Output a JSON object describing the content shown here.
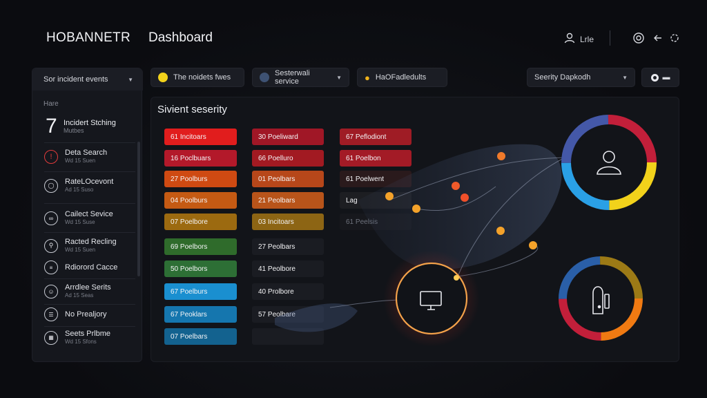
{
  "header": {
    "brand": "HOBANNETR",
    "title": "Dashboard",
    "user_label": "Lrle"
  },
  "sidebar": {
    "select_label": "Sor incident events",
    "section_label": "Hare",
    "feature": {
      "number": "7",
      "title": "Incidert Stching",
      "subtitle": "Mutbes"
    },
    "items": [
      {
        "title": "Deta Search",
        "subtitle": "Wd 15 Suen",
        "icon": "alert-icon"
      },
      {
        "title": "RateLOcevont",
        "subtitle": "Ad 15 Suso",
        "icon": "shield-icon"
      },
      {
        "title": "Cailect Sevice",
        "subtitle": "Wd 15 Suse",
        "icon": "service-icon"
      },
      {
        "title": "Racted Recling",
        "subtitle": "Wd 15 Suen",
        "icon": "search-icon"
      },
      {
        "title": "Rdiorord Cacce",
        "subtitle": "",
        "icon": "list-icon"
      },
      {
        "title": "Arrdlee Serits",
        "subtitle": "Ad 15 Seas",
        "icon": "person-icon"
      },
      {
        "title": "No Prealjory",
        "subtitle": "",
        "icon": "stack-icon"
      },
      {
        "title": "Seets Prlbme",
        "subtitle": "Wd 15 Sfons",
        "icon": "grid-icon"
      }
    ]
  },
  "filters": {
    "severity_filter": "The noidets fwes",
    "service_filter": "Sesterwali service",
    "owner_filter": "HaOFadledults",
    "dispatch_filter": "Seerity Dapkodh"
  },
  "main": {
    "title": "Sivient seserity",
    "columns": [
      [
        {
          "label": "61 Incitoars",
          "color": "#e11d1d"
        },
        {
          "label": "16 Poclbuars",
          "color": "#b3192a"
        },
        {
          "label": "27 Poolburs",
          "color": "#cf4a12"
        },
        {
          "label": "04 Poolburs",
          "color": "#c55a13"
        },
        {
          "label": "07 Poelbore",
          "color": "#9c6a10"
        },
        {
          "label": "69 Poelbors",
          "color": "#2f6b2b"
        },
        {
          "label": "50 Poelbors",
          "color": "#2d6f35"
        },
        {
          "label": "67 Poelburs",
          "color": "#1a8fd0"
        },
        {
          "label": "67 Peoklars",
          "color": "#1576ae"
        },
        {
          "label": "07 Poelbars",
          "color": "#13628f"
        }
      ],
      [
        {
          "label": "30 Poeliward",
          "color": "#a01726"
        },
        {
          "label": "66 Poelluro",
          "color": "#a21a22"
        },
        {
          "label": "01 Peolbars",
          "color": "#b7471a"
        },
        {
          "label": "21 Peolbars",
          "color": "#b8541a"
        },
        {
          "label": "03 Incitoars",
          "color": "#8d6514"
        },
        {
          "label": "27 Peolbars",
          "color": "#1a1c22"
        },
        {
          "label": "41 Peolbore",
          "color": "#1a1c22"
        },
        {
          "label": "40 Prolbore",
          "color": "#1a1c22"
        },
        {
          "label": "57 Peolbare",
          "color": "#1a1c22"
        },
        {
          "label": "",
          "color": "#1a1c22"
        }
      ],
      [
        {
          "label": "67 Peflodiont",
          "color": "#9f1c25"
        },
        {
          "label": "61 Poelbon",
          "color": "#a31b26"
        },
        {
          "label": "61 Poelwent",
          "color": "#2a1a1c"
        },
        {
          "label": "Lag",
          "color": "#1d1e22"
        },
        {
          "label": "61 Peelsis",
          "color": "#17181d"
        }
      ]
    ]
  },
  "colors": {
    "accent_red": "#e11d1d",
    "accent_yellow": "#f2d21b",
    "ring_blue": "#2aa0e6",
    "ring_green": "#b7e32a",
    "ring_orange": "#f07a12"
  }
}
